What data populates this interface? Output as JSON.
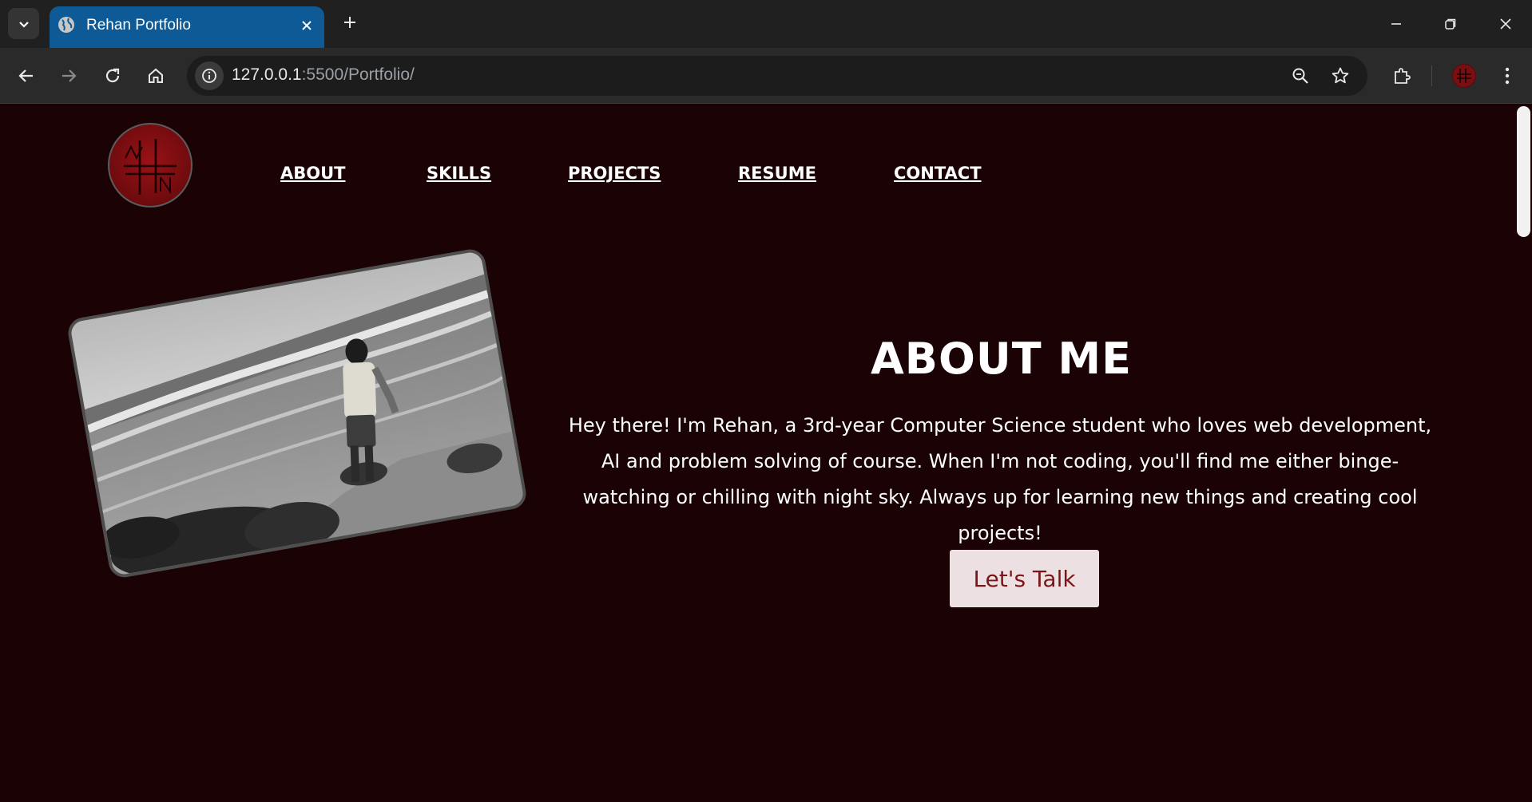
{
  "browser": {
    "tab": {
      "title": "Rehan Portfolio",
      "favicon": "globe-icon"
    },
    "url": {
      "host": "127.0.0.1",
      "path": ":5500/Portfolio/"
    },
    "icons": {
      "tab_list": "chevron-down-icon",
      "tab_close": "close-icon",
      "new_tab": "plus-icon",
      "minimize": "minimize-icon",
      "restore": "restore-icon",
      "close_window": "close-icon",
      "back": "back-arrow-icon",
      "forward": "forward-arrow-icon",
      "reload": "reload-icon",
      "home": "home-icon",
      "site_info": "info-icon",
      "zoom": "zoom-icon",
      "bookmark": "star-icon",
      "extensions": "puzzle-icon",
      "menu": "kebab-menu-icon"
    },
    "colors": {
      "tab_active": "#0d5a96",
      "frame": "#202020",
      "toolbar": "#2a2a2a"
    }
  },
  "page": {
    "nav": [
      "ABOUT",
      "SKILLS",
      "PROJECTS",
      "RESUME",
      "CONTACT"
    ],
    "about": {
      "title": "ABOUT ME",
      "body": "Hey there! I'm Rehan, a 3rd-year Computer Science student who loves web development, AI and problem solving of course. When I'm not coding, you'll find me either binge-watching or chilling with night sky. Always up for learning new things and creating cool projects!",
      "cta": "Let's Talk"
    },
    "colors": {
      "background": "#1b0305",
      "button_bg": "#ece0e2",
      "button_text": "#7d1518",
      "logo": "#7a0f12"
    }
  }
}
